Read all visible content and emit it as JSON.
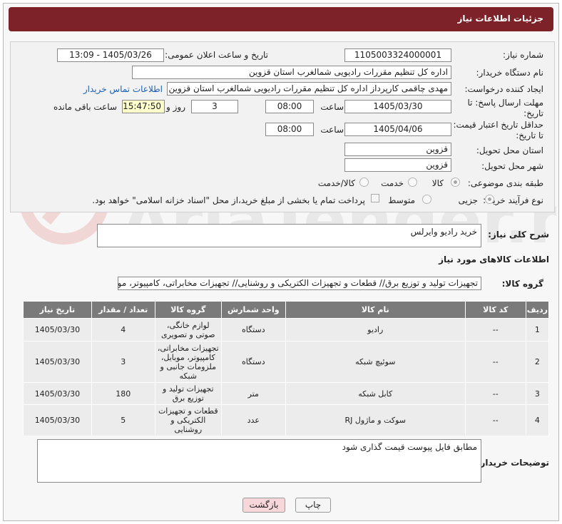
{
  "header": {
    "title": "جزئیات اطلاعات نیاز"
  },
  "form": {
    "need_number_label": "شماره نیاز:",
    "need_number": "1105003324000001",
    "announce_label": "تاریخ و ساعت اعلان عمومی:",
    "announce_value": "1405/03/26 - 13:09",
    "buyer_label": "نام دستگاه خریدار:",
    "buyer_value": "اداره کل تنظیم مقررات رادیویی شمالغرب استان قزوین",
    "creator_label": "ایجاد کننده درخواست:",
    "creator_value": "مهدی  چاقمی کارپرداز اداره کل تنظیم مقررات رادیویی شمالغرب استان قزوین",
    "contact_link": "اطلاعات تماس خریدار",
    "reply_deadline_label": "مهلت ارسال پاسخ: تا تاریخ:",
    "reply_date": "1405/03/30",
    "time_label": "ساعت",
    "reply_time": "08:00",
    "days": "3",
    "days_label": "روز و",
    "remaining_time": "15:47:50",
    "remaining_label": "ساعت باقی مانده",
    "price_deadline_label": "حداقل تاریخ اعتبار قیمت: تا تاریخ:",
    "price_date": "1405/04/06",
    "price_time": "08:00",
    "province_label": "استان محل تحویل:",
    "province_value": "قزوین",
    "city_label": "شهر محل تحویل:",
    "city_value": "قزوین",
    "category_label": "طبقه بندی موضوعی:",
    "category_options": [
      "کالا",
      "خدمت",
      "کالا/خدمت"
    ],
    "process_label": "نوع فرآیند خرید :",
    "process_options": [
      "جزیی",
      "متوسط"
    ],
    "payment_note": "پرداخت تمام یا بخشی از مبلغ خرید،از محل \"اسناد خزانه اسلامی\" خواهد بود."
  },
  "summary": {
    "label": "شرح کلی نیاز:",
    "value": "خرید رادیو وایرلس"
  },
  "goods_section": {
    "title": "اطلاعات کالاهای مورد نیاز",
    "group_label": "گروه کالا:",
    "group_value": "تجهیزات تولید و توزیع برق// قطعات و تجهیزات الکتریکی و روشنایی// تجهیزات مخابراتی، کامپیوتر، موبایل، ملزو"
  },
  "table": {
    "headers": [
      "ردیف",
      "کد کالا",
      "نام کالا",
      "واحد شمارش",
      "گروه کالا",
      "تعداد / مقدار",
      "تاریخ نیاز"
    ],
    "rows": [
      {
        "row": "1",
        "code": "--",
        "name": "رادیو",
        "unit": "دستگاه",
        "group": "لوازم خانگی، صوتی و تصویری",
        "qty": "4",
        "date": "1405/03/30"
      },
      {
        "row": "2",
        "code": "--",
        "name": "سوئیچ شبکه",
        "unit": "دستگاه",
        "group": "تجهیزات مخابراتی، کامپیوتر، موبایل، ملزومات جانبی و شبکه",
        "qty": "3",
        "date": "1405/03/30"
      },
      {
        "row": "3",
        "code": "--",
        "name": "کابل شبکه",
        "unit": "متر",
        "group": "تجهیزات تولید و توزیع برق",
        "qty": "180",
        "date": "1405/03/30"
      },
      {
        "row": "4",
        "code": "--",
        "name": "سوکت و ماژول RJ",
        "unit": "عدد",
        "group": "قطعات و تجهیزات الکتریکی و روشنایی",
        "qty": "5",
        "date": "1405/03/30"
      }
    ]
  },
  "buyer_notes": {
    "label": "توضیحات خریدار:",
    "value": "مطابق فایل پیوست قیمت گذاری شود"
  },
  "buttons": {
    "print": "چاپ",
    "back": "بازگشت"
  },
  "colors": {
    "header_bg": "#7d2228",
    "table_header_bg": "#7a7a7a",
    "back_button_bg": "#f8d7da"
  }
}
